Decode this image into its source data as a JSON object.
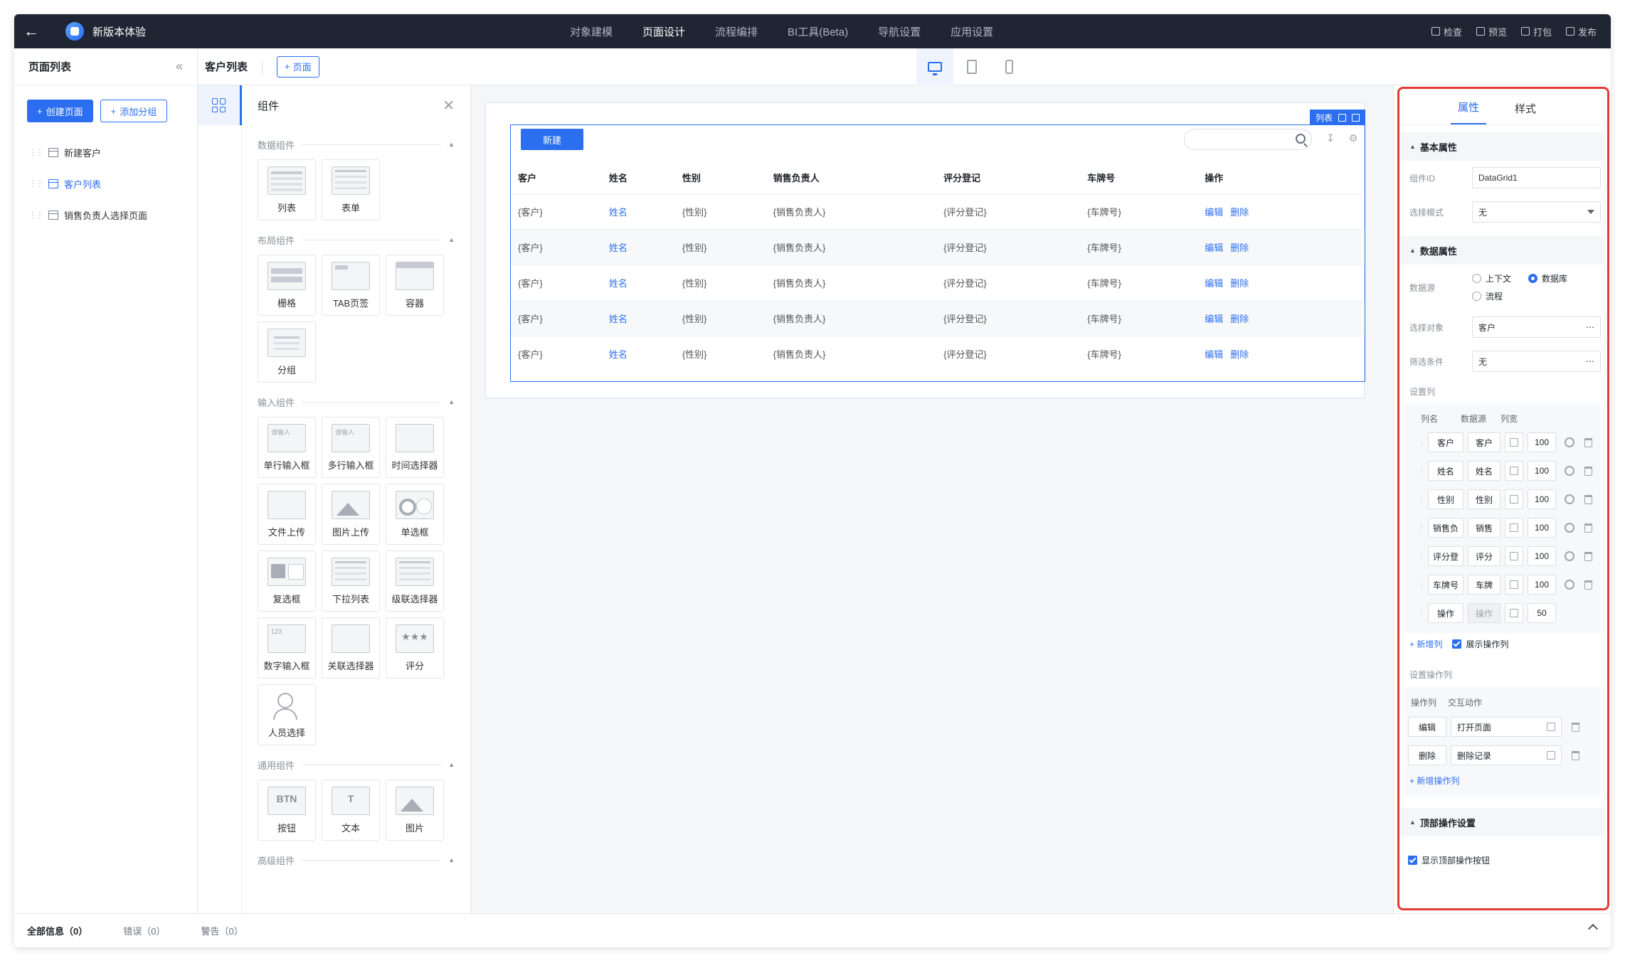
{
  "app": {
    "name": "新版本体验"
  },
  "topnav": [
    {
      "label": "对象建模"
    },
    {
      "label": "页面设计",
      "active": true
    },
    {
      "label": "流程编排"
    },
    {
      "label": "BI工具(Beta)"
    },
    {
      "label": "导航设置"
    },
    {
      "label": "应用设置"
    }
  ],
  "topactions": {
    "check": "检查",
    "preview": "预览",
    "package": "打包",
    "publish": "发布"
  },
  "pagelist": {
    "title": "页面列表",
    "create_btn": "创建页面",
    "group_btn": "添加分组",
    "items": [
      "新建客户",
      "客户列表",
      "销售负责人选择页面"
    ]
  },
  "subbar": {
    "title": "客户列表",
    "add_page": "页面"
  },
  "components": {
    "title": "组件",
    "sections": {
      "data": "数据组件",
      "layout": "布局组件",
      "input": "输入组件",
      "general": "通用组件",
      "advanced": "高级组件"
    },
    "data_items": [
      "列表",
      "表单"
    ],
    "layout_items": [
      "栅格",
      "TAB页签",
      "容器",
      "分组"
    ],
    "input_items": [
      "单行输入框",
      "多行输入框",
      "时间选择器",
      "文件上传",
      "图片上传",
      "单选框",
      "复选框",
      "下拉列表",
      "级联选择器",
      "数字输入框",
      "关联选择器",
      "评分",
      "人员选择"
    ],
    "general_items": [
      "按钮",
      "文本",
      "图片"
    ],
    "thumb_text": {
      "input": "请输入",
      "number": "123",
      "btn": "BTN",
      "text": "T"
    }
  },
  "canvas": {
    "tag": "列表",
    "new_btn": "新建",
    "columns": [
      "客户",
      "姓名",
      "性别",
      "销售负责人",
      "评分登记",
      "车牌号",
      "操作"
    ],
    "row": [
      "{客户}",
      "姓名",
      "{性别}",
      "{销售负责人}",
      "{评分登记}",
      "{车牌号}"
    ],
    "ops": [
      "编辑",
      "删除"
    ]
  },
  "props": {
    "tabs": [
      "属性",
      "样式"
    ],
    "basic": {
      "title": "基本属性",
      "id_label": "组件ID",
      "id_value": "DataGrid1",
      "mode_label": "选择模式",
      "mode_value": "无"
    },
    "data": {
      "title": "数据属性",
      "source_label": "数据源",
      "source_opts": [
        "上下文",
        "数据库",
        "流程"
      ],
      "object_label": "选择对象",
      "object_value": "客户",
      "filter_label": "筛选条件",
      "filter_value": "无",
      "cols_label": "设置列",
      "cols_header": [
        "列名",
        "数据源",
        "列宽"
      ],
      "cols": [
        {
          "name": "客户",
          "src": "客户",
          "w": "100"
        },
        {
          "name": "姓名",
          "src": "姓名",
          "w": "100"
        },
        {
          "name": "性别",
          "src": "性别",
          "w": "100"
        },
        {
          "name": "销售负",
          "src": "销售",
          "w": "100"
        },
        {
          "name": "评分登",
          "src": "评分",
          "w": "100"
        },
        {
          "name": "车牌号",
          "src": "车牌",
          "w": "100"
        },
        {
          "name": "操作",
          "src": "操作",
          "w": "50"
        }
      ],
      "add_col": "新增列",
      "show_ops": "展示操作列",
      "ops_label": "设置操作列",
      "ops_header": [
        "操作列",
        "交互动作"
      ],
      "ops": [
        {
          "name": "编辑",
          "action": "打开页面"
        },
        {
          "name": "删除",
          "action": "删除记录"
        }
      ],
      "add_op": "新增操作列"
    },
    "top": {
      "title": "顶部操作设置",
      "show_top": "显示顶部操作按钮"
    }
  },
  "bottom": {
    "all": "全部信息（0）",
    "errors": "错误（0）",
    "warnings": "警告（0）"
  }
}
